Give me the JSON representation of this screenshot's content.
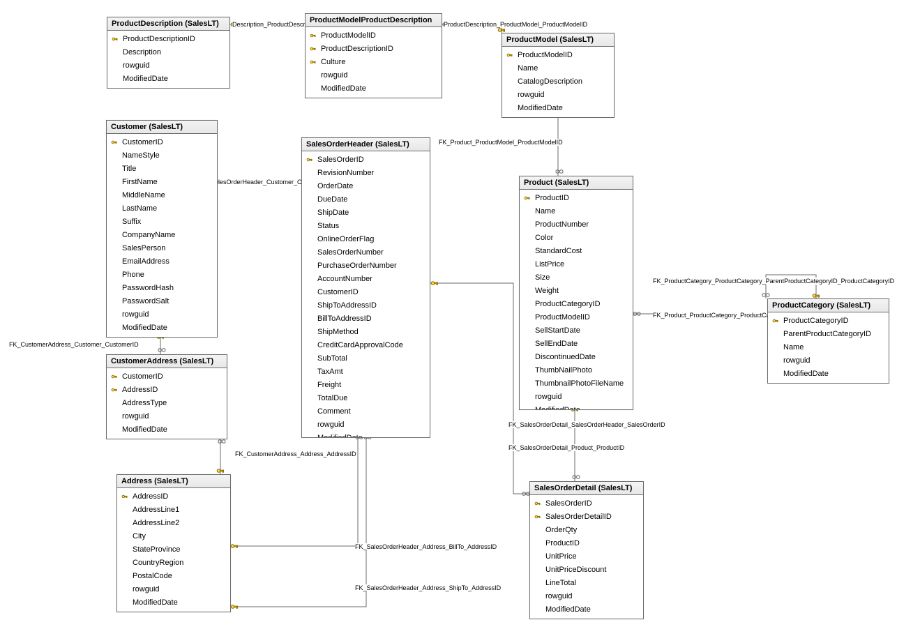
{
  "tables": {
    "productDescription": {
      "title": "ProductDescription (SalesLT)",
      "columns": [
        {
          "pk": true,
          "name": "ProductDescriptionID"
        },
        {
          "pk": false,
          "name": "Description"
        },
        {
          "pk": false,
          "name": "rowguid"
        },
        {
          "pk": false,
          "name": "ModifiedDate"
        }
      ]
    },
    "productModelProductDescription": {
      "title": "ProductModelProductDescription",
      "columns": [
        {
          "pk": true,
          "name": "ProductModelID"
        },
        {
          "pk": true,
          "name": "ProductDescriptionID"
        },
        {
          "pk": true,
          "name": "Culture"
        },
        {
          "pk": false,
          "name": "rowguid"
        },
        {
          "pk": false,
          "name": "ModifiedDate"
        }
      ]
    },
    "productModel": {
      "title": "ProductModel (SalesLT)",
      "columns": [
        {
          "pk": true,
          "name": "ProductModelID"
        },
        {
          "pk": false,
          "name": "Name"
        },
        {
          "pk": false,
          "name": "CatalogDescription"
        },
        {
          "pk": false,
          "name": "rowguid"
        },
        {
          "pk": false,
          "name": "ModifiedDate"
        }
      ]
    },
    "customer": {
      "title": "Customer (SalesLT)",
      "columns": [
        {
          "pk": true,
          "name": "CustomerID"
        },
        {
          "pk": false,
          "name": "NameStyle"
        },
        {
          "pk": false,
          "name": "Title"
        },
        {
          "pk": false,
          "name": "FirstName"
        },
        {
          "pk": false,
          "name": "MiddleName"
        },
        {
          "pk": false,
          "name": "LastName"
        },
        {
          "pk": false,
          "name": "Suffix"
        },
        {
          "pk": false,
          "name": "CompanyName"
        },
        {
          "pk": false,
          "name": "SalesPerson"
        },
        {
          "pk": false,
          "name": "EmailAddress"
        },
        {
          "pk": false,
          "name": "Phone"
        },
        {
          "pk": false,
          "name": "PasswordHash"
        },
        {
          "pk": false,
          "name": "PasswordSalt"
        },
        {
          "pk": false,
          "name": "rowguid"
        },
        {
          "pk": false,
          "name": "ModifiedDate"
        }
      ]
    },
    "salesOrderHeader": {
      "title": "SalesOrderHeader (SalesLT)",
      "columns": [
        {
          "pk": true,
          "name": "SalesOrderID"
        },
        {
          "pk": false,
          "name": "RevisionNumber"
        },
        {
          "pk": false,
          "name": "OrderDate"
        },
        {
          "pk": false,
          "name": "DueDate"
        },
        {
          "pk": false,
          "name": "ShipDate"
        },
        {
          "pk": false,
          "name": "Status"
        },
        {
          "pk": false,
          "name": "OnlineOrderFlag"
        },
        {
          "pk": false,
          "name": "SalesOrderNumber"
        },
        {
          "pk": false,
          "name": "PurchaseOrderNumber"
        },
        {
          "pk": false,
          "name": "AccountNumber"
        },
        {
          "pk": false,
          "name": "CustomerID"
        },
        {
          "pk": false,
          "name": "ShipToAddressID"
        },
        {
          "pk": false,
          "name": "BillToAddressID"
        },
        {
          "pk": false,
          "name": "ShipMethod"
        },
        {
          "pk": false,
          "name": "CreditCardApprovalCode"
        },
        {
          "pk": false,
          "name": "SubTotal"
        },
        {
          "pk": false,
          "name": "TaxAmt"
        },
        {
          "pk": false,
          "name": "Freight"
        },
        {
          "pk": false,
          "name": "TotalDue"
        },
        {
          "pk": false,
          "name": "Comment"
        },
        {
          "pk": false,
          "name": "rowguid"
        },
        {
          "pk": false,
          "name": "ModifiedDate"
        }
      ]
    },
    "product": {
      "title": "Product (SalesLT)",
      "columns": [
        {
          "pk": true,
          "name": "ProductID"
        },
        {
          "pk": false,
          "name": "Name"
        },
        {
          "pk": false,
          "name": "ProductNumber"
        },
        {
          "pk": false,
          "name": "Color"
        },
        {
          "pk": false,
          "name": "StandardCost"
        },
        {
          "pk": false,
          "name": "ListPrice"
        },
        {
          "pk": false,
          "name": "Size"
        },
        {
          "pk": false,
          "name": "Weight"
        },
        {
          "pk": false,
          "name": "ProductCategoryID"
        },
        {
          "pk": false,
          "name": "ProductModelID"
        },
        {
          "pk": false,
          "name": "SellStartDate"
        },
        {
          "pk": false,
          "name": "SellEndDate"
        },
        {
          "pk": false,
          "name": "DiscontinuedDate"
        },
        {
          "pk": false,
          "name": "ThumbNailPhoto"
        },
        {
          "pk": false,
          "name": "ThumbnailPhotoFileName"
        },
        {
          "pk": false,
          "name": "rowguid"
        },
        {
          "pk": false,
          "name": "ModifiedDate"
        }
      ]
    },
    "productCategory": {
      "title": "ProductCategory (SalesLT)",
      "columns": [
        {
          "pk": true,
          "name": "ProductCategoryID"
        },
        {
          "pk": false,
          "name": "ParentProductCategoryID"
        },
        {
          "pk": false,
          "name": "Name"
        },
        {
          "pk": false,
          "name": "rowguid"
        },
        {
          "pk": false,
          "name": "ModifiedDate"
        }
      ]
    },
    "customerAddress": {
      "title": "CustomerAddress (SalesLT)",
      "columns": [
        {
          "pk": true,
          "name": "CustomerID"
        },
        {
          "pk": true,
          "name": "AddressID"
        },
        {
          "pk": false,
          "name": "AddressType"
        },
        {
          "pk": false,
          "name": "rowguid"
        },
        {
          "pk": false,
          "name": "ModifiedDate"
        }
      ]
    },
    "address": {
      "title": "Address (SalesLT)",
      "columns": [
        {
          "pk": true,
          "name": "AddressID"
        },
        {
          "pk": false,
          "name": "AddressLine1"
        },
        {
          "pk": false,
          "name": "AddressLine2"
        },
        {
          "pk": false,
          "name": "City"
        },
        {
          "pk": false,
          "name": "StateProvince"
        },
        {
          "pk": false,
          "name": "CountryRegion"
        },
        {
          "pk": false,
          "name": "PostalCode"
        },
        {
          "pk": false,
          "name": "rowguid"
        },
        {
          "pk": false,
          "name": "ModifiedDate"
        }
      ]
    },
    "salesOrderDetail": {
      "title": "SalesOrderDetail (SalesLT)",
      "columns": [
        {
          "pk": true,
          "name": "SalesOrderID"
        },
        {
          "pk": true,
          "name": "SalesOrderDetailID"
        },
        {
          "pk": false,
          "name": "OrderQty"
        },
        {
          "pk": false,
          "name": "ProductID"
        },
        {
          "pk": false,
          "name": "UnitPrice"
        },
        {
          "pk": false,
          "name": "UnitPriceDiscount"
        },
        {
          "pk": false,
          "name": "LineTotal"
        },
        {
          "pk": false,
          "name": "rowguid"
        },
        {
          "pk": false,
          "name": "ModifiedDate"
        }
      ]
    }
  },
  "relationships": {
    "pmpd_pd": "Description_ProductDescriptio",
    "pmpd_pm": "ProductDescription_ProductModel_ProductModelID",
    "product_pm": "FK_Product_ProductModel_ProductModelID",
    "product_pc": "FK_Product_ProductCategory_ProductCategoryID",
    "pc_self": "FK_ProductCategory_ProductCategory_ParentProductCategoryID_ProductCategoryID",
    "soh_customer": "lesOrderHeader_Customer_Custo",
    "ca_customer": "FK_CustomerAddress_Customer_CustomerID",
    "ca_address": "FK_CustomerAddress_Address_AddressID",
    "soh_billto": "FK_SalesOrderHeader_Address_BillTo_AddressID",
    "soh_shipto": "FK_SalesOrderHeader_Address_ShipTo_AddressID",
    "sod_soh": "FK_SalesOrderDetail_SalesOrderHeader_SalesOrderID",
    "sod_product": "FK_SalesOrderDetail_Product_ProductID"
  }
}
